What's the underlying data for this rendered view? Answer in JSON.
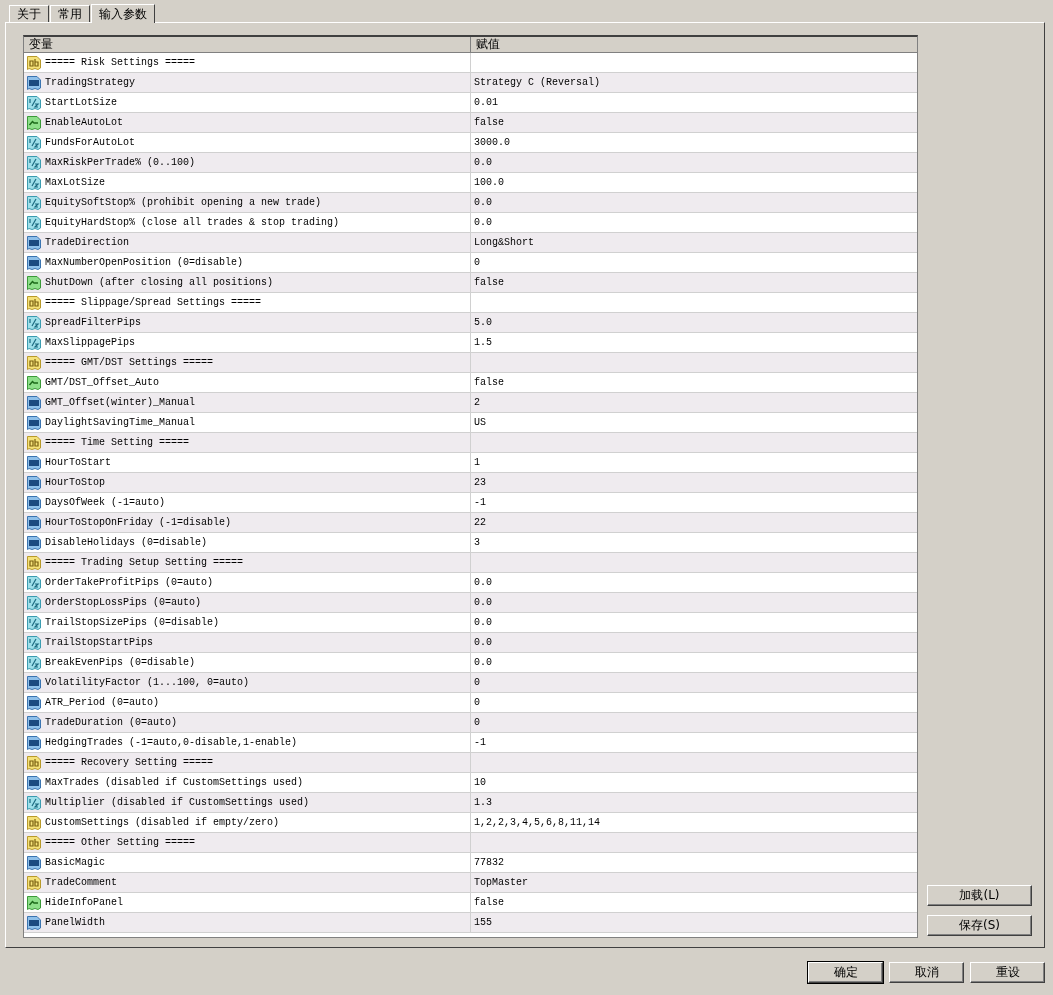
{
  "tabs": [
    {
      "label": "关于",
      "selected": false
    },
    {
      "label": "常用",
      "selected": false
    },
    {
      "label": "输入参数",
      "selected": true
    }
  ],
  "table": {
    "columns": [
      "变量",
      "赋值"
    ],
    "rows": [
      {
        "kind": "string",
        "name": "===== Risk Settings ====="
      },
      {
        "kind": "int",
        "name": "TradingStrategy",
        "value": "Strategy C (Reversal)"
      },
      {
        "kind": "double",
        "name": "StartLotSize",
        "value": "0.01"
      },
      {
        "kind": "bool",
        "name": "EnableAutoLot",
        "value": "false"
      },
      {
        "kind": "double",
        "name": "FundsForAutoLot",
        "value": "3000.0"
      },
      {
        "kind": "double",
        "name": "MaxRiskPerTrade% (0..100)",
        "value": "0.0"
      },
      {
        "kind": "double",
        "name": "MaxLotSize",
        "value": "100.0"
      },
      {
        "kind": "double",
        "name": "EquitySoftStop% (prohibit opening a new trade)",
        "value": "0.0"
      },
      {
        "kind": "double",
        "name": "EquityHardStop% (close all trades & stop trading)",
        "value": "0.0"
      },
      {
        "kind": "int",
        "name": "TradeDirection",
        "value": "Long&Short"
      },
      {
        "kind": "int",
        "name": "MaxNumberOpenPosition (0=disable)",
        "value": "0"
      },
      {
        "kind": "bool",
        "name": "ShutDown (after closing all positions)",
        "value": "false"
      },
      {
        "kind": "string",
        "name": "===== Slippage/Spread Settings ====="
      },
      {
        "kind": "double",
        "name": "SpreadFilterPips",
        "value": "5.0"
      },
      {
        "kind": "double",
        "name": "MaxSlippagePips",
        "value": "1.5"
      },
      {
        "kind": "string",
        "name": "===== GMT/DST Settings ====="
      },
      {
        "kind": "bool",
        "name": "GMT/DST_Offset_Auto",
        "value": "false"
      },
      {
        "kind": "int",
        "name": "GMT_Offset(winter)_Manual",
        "value": "2"
      },
      {
        "kind": "int",
        "name": "DaylightSavingTime_Manual",
        "value": "US"
      },
      {
        "kind": "string",
        "name": "===== Time Setting ====="
      },
      {
        "kind": "int",
        "name": "HourToStart",
        "value": "1"
      },
      {
        "kind": "int",
        "name": "HourToStop",
        "value": "23"
      },
      {
        "kind": "int",
        "name": "DaysOfWeek (-1=auto)",
        "value": "-1"
      },
      {
        "kind": "int",
        "name": "HourToStopOnFriday (-1=disable)",
        "value": "22"
      },
      {
        "kind": "int",
        "name": "DisableHolidays (0=disable)",
        "value": "3"
      },
      {
        "kind": "string",
        "name": "===== Trading Setup Setting ====="
      },
      {
        "kind": "double",
        "name": "OrderTakeProfitPips (0=auto)",
        "value": "0.0"
      },
      {
        "kind": "double",
        "name": "OrderStopLossPips (0=auto)",
        "value": "0.0"
      },
      {
        "kind": "double",
        "name": "TrailStopSizePips (0=disable)",
        "value": "0.0"
      },
      {
        "kind": "double",
        "name": "TrailStopStartPips",
        "value": "0.0"
      },
      {
        "kind": "double",
        "name": "BreakEvenPips (0=disable)",
        "value": "0.0"
      },
      {
        "kind": "int",
        "name": "VolatilityFactor (1...100, 0=auto)",
        "value": "0"
      },
      {
        "kind": "int",
        "name": "ATR_Period (0=auto)",
        "value": "0"
      },
      {
        "kind": "int",
        "name": "TradeDuration (0=auto)",
        "value": "0"
      },
      {
        "kind": "int",
        "name": "HedgingTrades (-1=auto,0-disable,1-enable)",
        "value": "-1"
      },
      {
        "kind": "string",
        "name": "===== Recovery Setting ====="
      },
      {
        "kind": "int",
        "name": "MaxTrades (disabled if CustomSettings used)",
        "value": "10"
      },
      {
        "kind": "double",
        "name": "Multiplier (disabled if CustomSettings used)",
        "value": "1.3"
      },
      {
        "kind": "string",
        "name": "CustomSettings (disabled if empty/zero)",
        "value": "1,2,2,3,4,5,6,8,11,14"
      },
      {
        "kind": "string",
        "name": "===== Other Setting ====="
      },
      {
        "kind": "int",
        "name": "BasicMagic",
        "value": "77832"
      },
      {
        "kind": "string",
        "name": "TradeComment",
        "value": "TopMaster"
      },
      {
        "kind": "bool",
        "name": "HideInfoPanel",
        "value": "false"
      },
      {
        "kind": "int",
        "name": "PanelWidth",
        "value": "155"
      }
    ]
  },
  "side_buttons": [
    "加载(L)",
    "保存(S)"
  ],
  "buttons": [
    "确定",
    "取消",
    "重设"
  ]
}
